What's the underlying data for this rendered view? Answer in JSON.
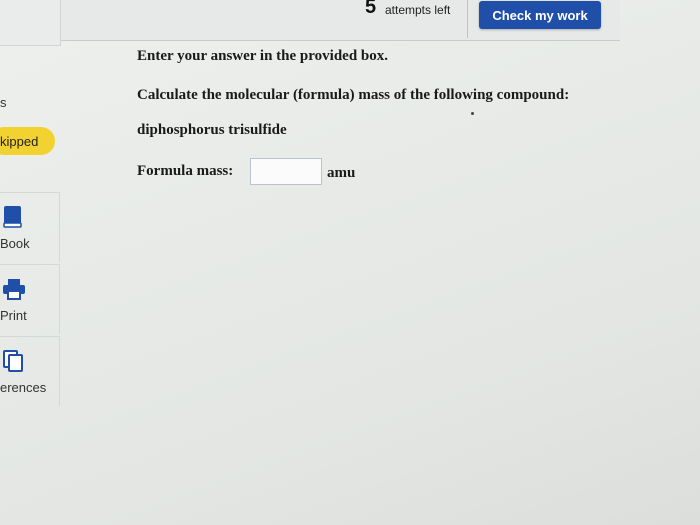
{
  "header": {
    "attempts_count": "5",
    "attempts_label": "attempts left",
    "check_button": "Check my work"
  },
  "sidebar": {
    "section_label_fragment": "s",
    "status_badge": "kipped",
    "tools": [
      {
        "label": "Book",
        "icon": "book-icon"
      },
      {
        "label": "Print",
        "icon": "printer-icon"
      },
      {
        "label": "erences",
        "icon": "references-icon"
      }
    ]
  },
  "question": {
    "instruction": "Enter your answer in the provided box.",
    "prompt": "Calculate the molecular (formula) mass of the following compound:",
    "compound": "diphosphorus trisulfide",
    "field_label": "Formula mass:",
    "field_value": "",
    "unit": "amu"
  },
  "colors": {
    "accent_button": "#1f4fa8",
    "badge": "#f2d230",
    "tool_icon": "#1f4fa8"
  }
}
